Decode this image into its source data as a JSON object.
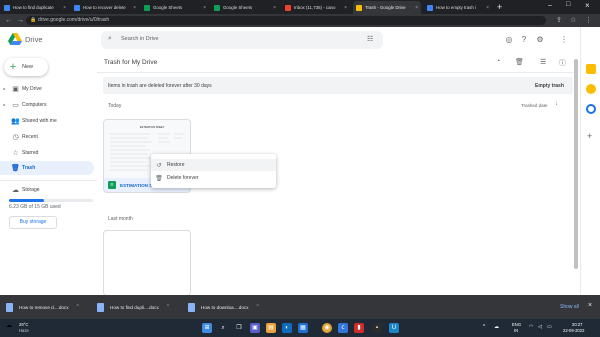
{
  "browser": {
    "tabs": [
      {
        "title": "How to find duplicate",
        "color": "#4285f4"
      },
      {
        "title": "How to recover delete",
        "color": "#4285f4"
      },
      {
        "title": "Google Sheets",
        "color": "#0f9d58"
      },
      {
        "title": "Google Sheets",
        "color": "#0f9d58"
      },
      {
        "title": "Inbox (11,736) - cano",
        "color": "#ea4335"
      },
      {
        "title": "Trash - Google Drive",
        "color": "#fbbc04"
      },
      {
        "title": "How to empty trash i",
        "color": "#4285f4"
      }
    ],
    "url": "drive.google.com/drive/u/0/trash"
  },
  "drive": {
    "logo_text": "Drive",
    "search_placeholder": "Search in Drive",
    "avatar_letter": "T"
  },
  "sidebar": {
    "new_label": "New",
    "items": [
      {
        "label": "My Drive",
        "icon": "my-drive-icon"
      },
      {
        "label": "Computers",
        "icon": "computers-icon"
      },
      {
        "label": "Shared with me",
        "icon": "shared-icon"
      },
      {
        "label": "Recent",
        "icon": "recent-icon"
      },
      {
        "label": "Starred",
        "icon": "star-icon"
      },
      {
        "label": "Trash",
        "icon": "trash-icon"
      }
    ],
    "storage_label": "Storage",
    "storage_used_text": "6.23 GB of 15 GB used",
    "storage_fraction": 0.415,
    "buy_storage": "Buy storage"
  },
  "main": {
    "title": "Trash for My Drive",
    "banner_text": "Items in trash are deleted forever after 30 days",
    "empty_trash": "Empty trash",
    "section_today": "Today",
    "sort_label": "Trashed date",
    "section_last_month": "Last month",
    "file_name": "ESTIMATION SHEET",
    "thumb_title": "ESTIMATION SHEET"
  },
  "context_menu": {
    "items": [
      {
        "label": "Restore",
        "icon": "restore-icon"
      },
      {
        "label": "Delete forever",
        "icon": "delete-forever-icon"
      }
    ]
  },
  "downloads": {
    "items": [
      {
        "label": "How to remove d....docx"
      },
      {
        "label": "How to find dupli....docx"
      },
      {
        "label": "How to downloa....docx"
      }
    ],
    "show_all": "Show all"
  },
  "taskbar": {
    "weather_temp": "29°C",
    "weather_desc": "Haze",
    "lang": "ENG",
    "lang2": "IN",
    "time": "20:27",
    "date": "22-09-2022"
  }
}
